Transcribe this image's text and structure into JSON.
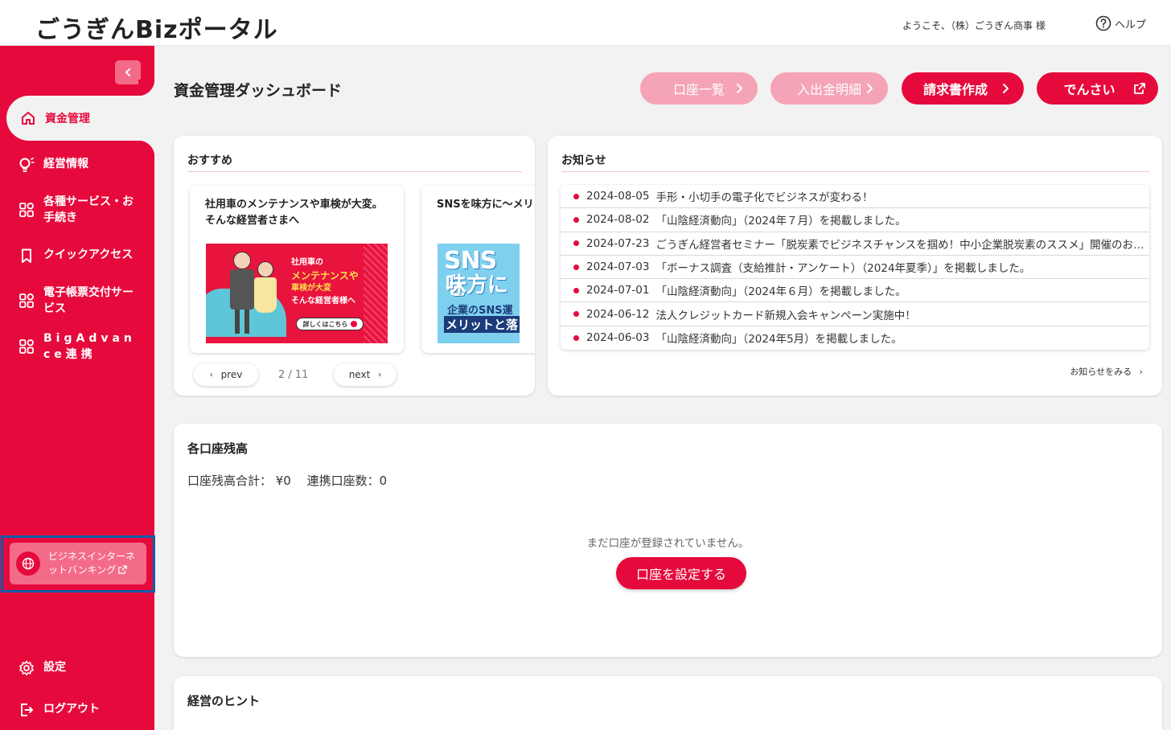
{
  "header": {
    "logo": "ごうぎんBizポータル",
    "welcome": "ようこそ、（株）ごうぎん商事 様",
    "help_label": "ヘルプ"
  },
  "sidebar": {
    "items": [
      {
        "label": "資金管理",
        "icon": "home-icon",
        "active": true
      },
      {
        "label": "経営情報",
        "icon": "lightbulb-icon"
      },
      {
        "label": "各種サービス・お手続き",
        "icon": "grid-icon"
      },
      {
        "label": "クイックアクセス",
        "icon": "bookmark-icon"
      },
      {
        "label": "電子帳票交付サービス",
        "icon": "grid-icon"
      },
      {
        "label": "BigAdvance連携",
        "icon": "grid-icon"
      }
    ],
    "internet_banking": "ビジネスインターネットバンキング",
    "settings": "設定",
    "logout": "ログアウト"
  },
  "main": {
    "title": "資金管理ダッシュボード",
    "buttons": {
      "accounts": "口座一覧",
      "transactions": "入出金明細",
      "invoice": "請求書作成",
      "densai": "でんさい"
    }
  },
  "recommend": {
    "title": "おすすめ",
    "cards": [
      {
        "title": "社用車のメンテナンスや車検が大変。そんな経営者さまへ",
        "banner_lines": [
          "社用車の",
          "メンテナンスや",
          "車検が大変",
          "そんな経営者様へ"
        ],
        "banner_button": "詳しくはこちら"
      },
      {
        "title": "SNSを味方に〜メリットと落とし穴",
        "banner_lines": [
          "SNSを",
          "味方に",
          "企業のSNS運",
          "メリットと落"
        ]
      }
    ],
    "pager": {
      "prev": "prev",
      "next": "next",
      "count": "2 / 11"
    }
  },
  "news": {
    "title": "お知らせ",
    "items": [
      {
        "date": "2024-08-05",
        "text": "手形・小切手の電子化でビジネスが変わる！"
      },
      {
        "date": "2024-08-02",
        "text": "「山陰経済動向」（2024年７月）を掲載しました。"
      },
      {
        "date": "2024-07-23",
        "text": "ごうぎん経営者セミナー「脱炭素でビジネスチャンスを掴め！中小企業脱炭素のススメ」開催のお知らせ"
      },
      {
        "date": "2024-07-03",
        "text": "「ボーナス調査（支給推計・アンケート）（2024年夏季）」を掲載しました。"
      },
      {
        "date": "2024-07-01",
        "text": "「山陰経済動向」（2024年６月）を掲載しました。"
      },
      {
        "date": "2024-06-12",
        "text": "法人クレジットカード新規入会キャンペーン実施中！"
      },
      {
        "date": "2024-06-03",
        "text": "「山陰経済動向」（2024年5月）を掲載しました。"
      }
    ],
    "more": "お知らせをみる"
  },
  "balances": {
    "title": "各口座残高",
    "summary": "口座残高合計： ¥0　 連携口座数：0",
    "empty": "まだ口座が登録されていません。",
    "setup_button": "口座を設定する"
  },
  "hints": {
    "title": "経営のヒント"
  },
  "colors": {
    "brand": "#e60a3c",
    "brand_light": "#f5a3b6",
    "highlight_border": "#0a5cab"
  }
}
